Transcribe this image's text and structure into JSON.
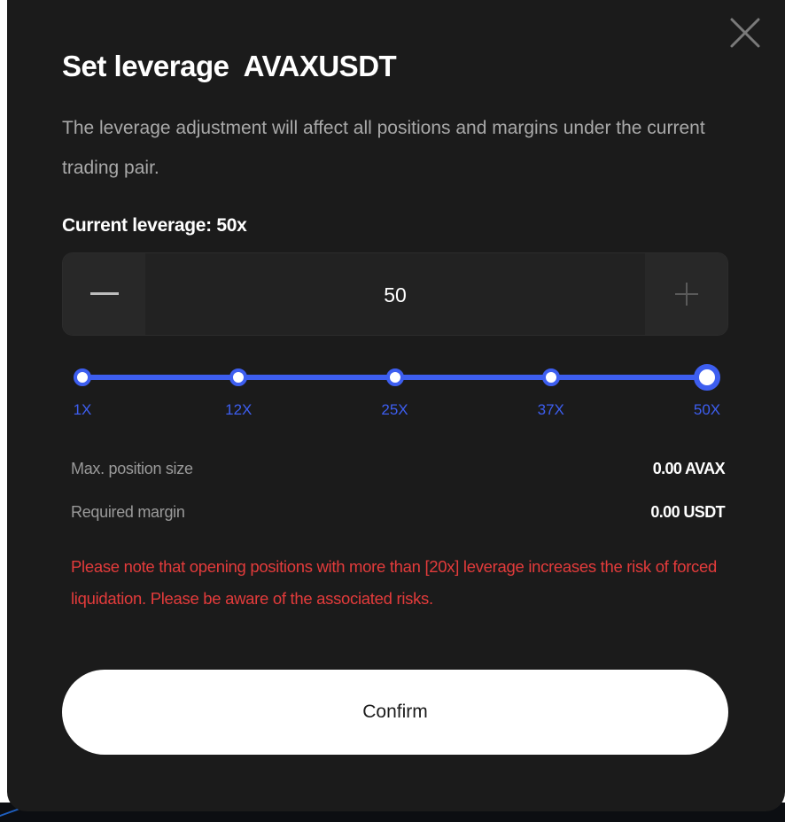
{
  "dialog": {
    "title": "Set leverage  AVAXUSDT",
    "description": "The leverage adjustment will affect all positions and margins under the current trading pair.",
    "current_leverage_label": "Current leverage: 50x",
    "close_icon": "close-icon"
  },
  "stepper": {
    "value": "50",
    "minus_icon": "minus-icon",
    "plus_icon": "plus-icon"
  },
  "slider": {
    "min": 1,
    "max": 50,
    "value": 50,
    "ticks": [
      {
        "label": "1X",
        "value": 1
      },
      {
        "label": "12X",
        "value": 12
      },
      {
        "label": "25X",
        "value": 25
      },
      {
        "label": "37X",
        "value": 37
      },
      {
        "label": "50X",
        "value": 50
      }
    ]
  },
  "info": {
    "max_position_label": "Max. position size",
    "max_position_value": "0.00 AVAX",
    "required_margin_label": "Required margin",
    "required_margin_value": "0.00 USDT"
  },
  "warning": "Please note that opening positions with more than [20x] leverage increases the risk of forced liquidation. Please be aware of the associated risks.",
  "confirm_label": "Confirm",
  "colors": {
    "background": "#1b1b1b",
    "accent": "#3d5ef0",
    "warning": "#e33b3b",
    "text_primary": "#ffffff",
    "text_secondary": "#a9a9a9"
  }
}
